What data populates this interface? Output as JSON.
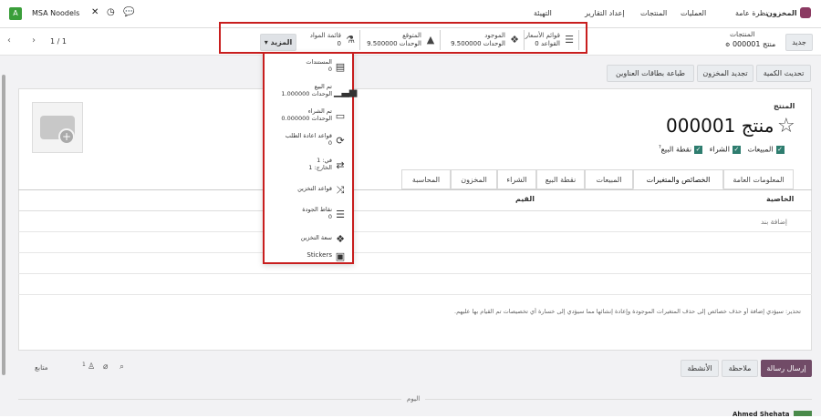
{
  "topbar": {
    "app_letter": "A",
    "company": "MSA Noodels",
    "app_name": "المخزون",
    "menu": [
      "نظرة عامة",
      "العمليات",
      "المنتجات",
      "إعداد التقارير",
      "التهيئة"
    ]
  },
  "control": {
    "new_label": "جديد",
    "breadcrumb_parent": "المنتجات",
    "breadcrumb_current": "منتج 000001",
    "pager": "1 / 1",
    "more_label": "المزيد",
    "stats": [
      {
        "title": "قوائم الأسعار",
        "value": "0 القواعد",
        "icon": "list-icon"
      },
      {
        "title": "الموجود",
        "value": "9.500000 الوحدات",
        "icon": "cubes-icon"
      },
      {
        "title": "المتوقع",
        "value": "9.500000 الوحدات",
        "icon": "chart-area-icon"
      },
      {
        "title": "قائمة المواد",
        "value": "0",
        "icon": "flask-icon"
      }
    ]
  },
  "dropdown": [
    {
      "title": "المستندات",
      "value": "0",
      "icon": "document-icon"
    },
    {
      "title": "تم البيع",
      "value": "1.000000 الوحدات",
      "icon": "bar-chart-icon"
    },
    {
      "title": "تم الشراء",
      "value": "0.000000 الوحدات",
      "icon": "credit-card-icon"
    },
    {
      "title": "قواعد اعادة الطلب",
      "value": "0",
      "icon": "refresh-icon"
    },
    {
      "title": "في: 1",
      "value": "الخارج: 1",
      "icon": "exchange-icon"
    },
    {
      "title": "قواعد التخزين",
      "value": "",
      "icon": "random-icon"
    },
    {
      "title": "نقاط الجودة",
      "value": "0",
      "icon": "list-icon"
    },
    {
      "title": "سعة التخزين",
      "value": "",
      "icon": "cubes-icon"
    },
    {
      "title": "Stickers",
      "value": "",
      "icon": "image-icon"
    }
  ],
  "actions": [
    "تحديث الكمية",
    "تجديد المخزون",
    "طباعة بطاقات العناوين"
  ],
  "form": {
    "label": "المنتج",
    "product_name": "منتج 000001",
    "checks": [
      "المبيعات",
      "الشراء",
      "نقطة البيع"
    ],
    "pos_help": "?",
    "tabs": [
      "المعلومات العامة",
      "الخصائص والمتغيرات",
      "المبيعات",
      "نقطة البيع",
      "الشراء",
      "المخزون",
      "المحاسبة"
    ],
    "col_attribute": "الخاصية",
    "col_values": "القيم",
    "add_line": "إضافة بند",
    "warning": "تحذير: سيؤدي إضافة أو حذف خصائص إلى حذف المتغيرات الموجودة وإعادة إنشائها مما سيؤدي إلى خسارة أي تخصيصات تم القيام بها عليهم."
  },
  "chatter": {
    "send": "إرسال رسالة",
    "note": "ملاحظة",
    "activities": "الأنشطة",
    "follow": "متابع",
    "followers_count": "1",
    "today": "اليوم",
    "author": "Ahmed Shehata"
  }
}
